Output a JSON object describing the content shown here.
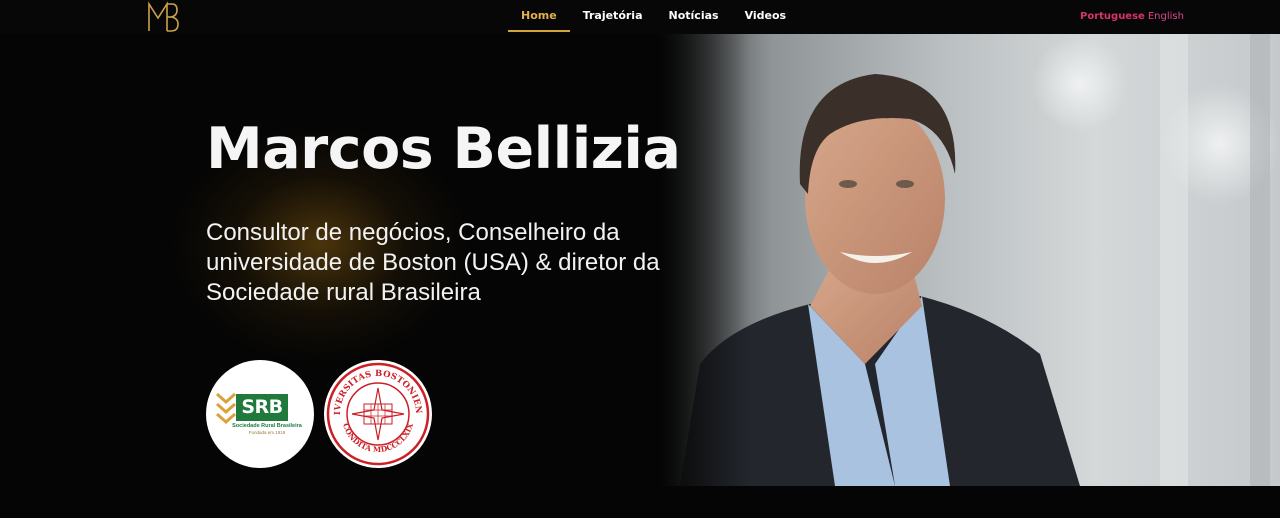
{
  "header": {
    "logo": "MB monogram",
    "nav": [
      {
        "label": "Home",
        "active": true
      },
      {
        "label": "Trajetória",
        "active": false
      },
      {
        "label": "Notícias",
        "active": false
      },
      {
        "label": "Videos",
        "active": false
      }
    ],
    "languages": {
      "portuguese": "Portuguese",
      "english": "English"
    }
  },
  "hero": {
    "title": "Marcos Bellizia",
    "subtitle": "Consultor de negócios, Conselheiro da universidade de Boston (USA) & diretor da Sociedade rural Brasileira",
    "portrait": "photo of smiling man in dark suit and light blue shirt",
    "logos": {
      "srb": {
        "acronym": "SRB",
        "name": "Sociedade Rural Brasileira",
        "founded": "Fundada em 1919"
      },
      "bu": {
        "top_text": "UNIVERSITAS BOSTONIENSIS",
        "bottom_text": "CONDITA MDCCCLXIX"
      }
    }
  },
  "colors": {
    "accent": "#e2b04c",
    "language": "#d6336c",
    "srb_green": "#1f7a3c",
    "bu_red": "#cc1f26"
  }
}
